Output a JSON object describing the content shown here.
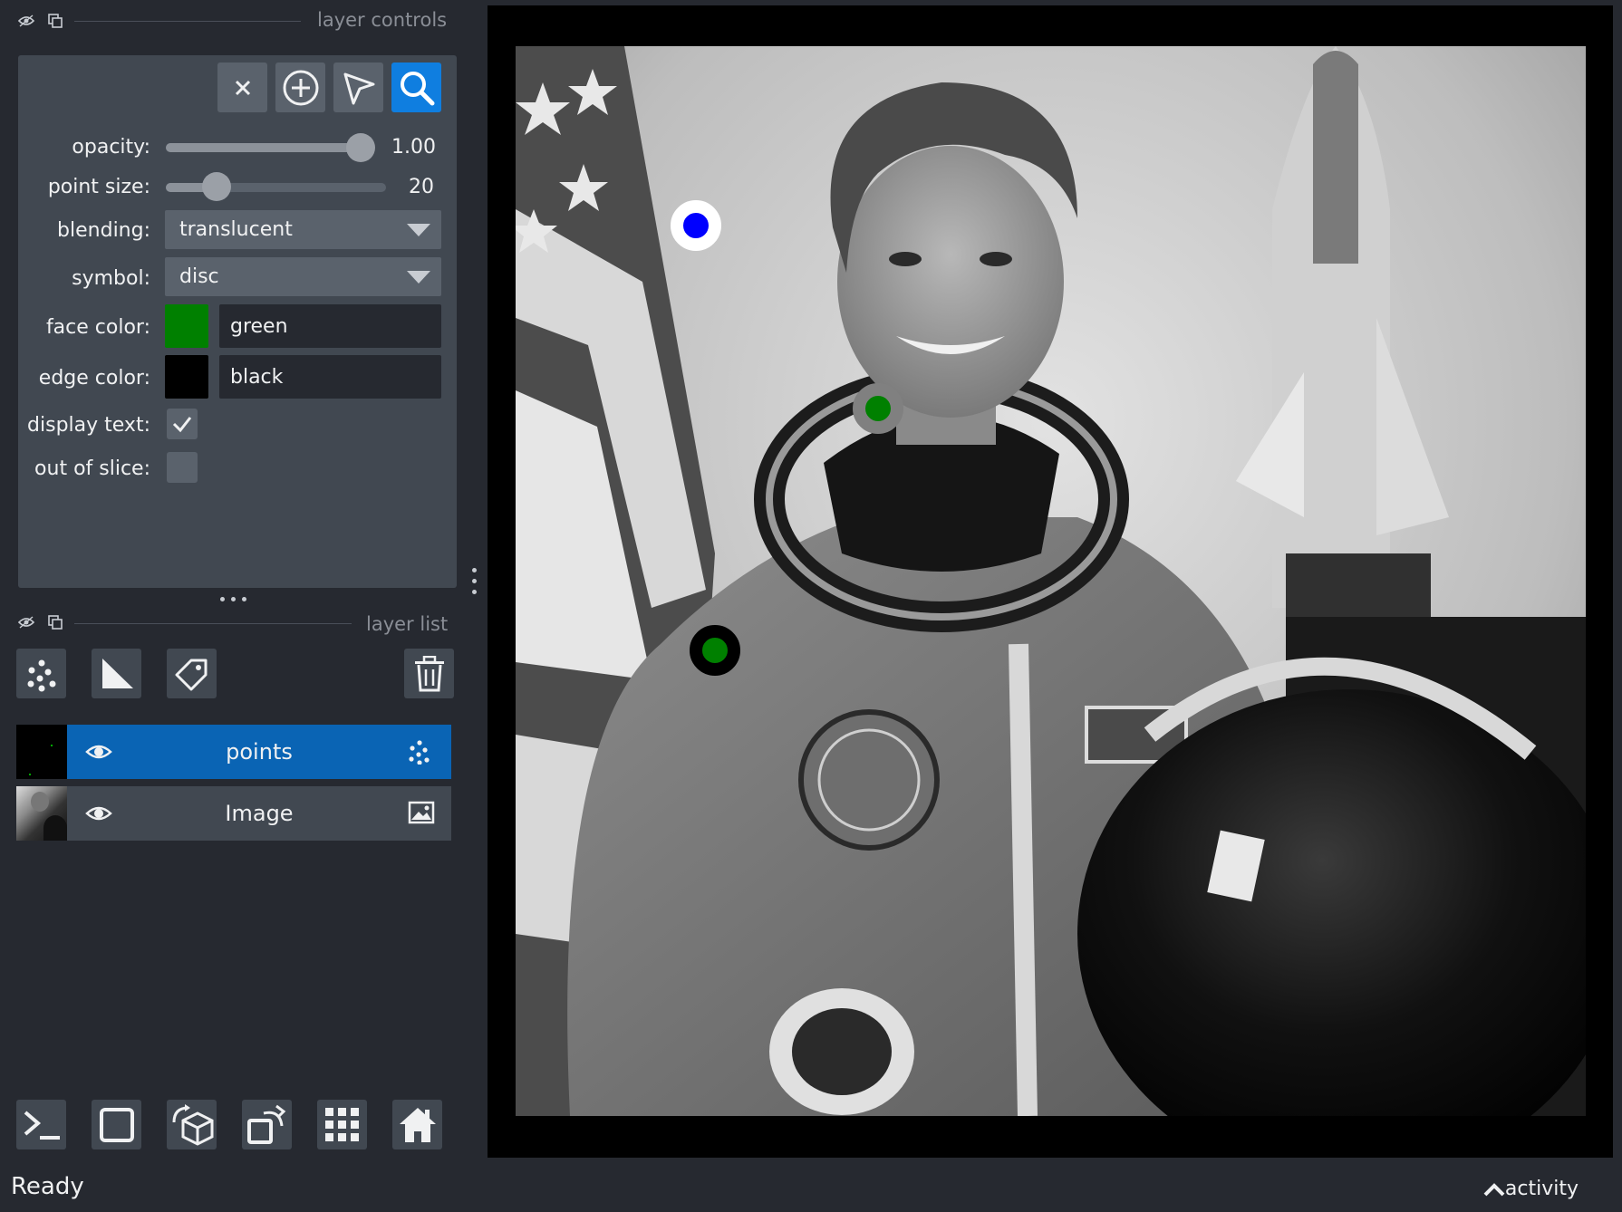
{
  "layer_controls": {
    "title": "layer controls",
    "tools": [
      "delete-selected",
      "add-points",
      "select-points",
      "pan-zoom"
    ],
    "opacity": {
      "label": "opacity:",
      "value": "1.00",
      "fraction": 1.0
    },
    "point_size": {
      "label": "point size:",
      "value": "20",
      "fraction": 0.2
    },
    "blending": {
      "label": "blending:",
      "value": "translucent"
    },
    "symbol": {
      "label": "symbol:",
      "value": "disc"
    },
    "face_color": {
      "label": "face color:",
      "value": "green",
      "swatch": "#008000"
    },
    "edge_color": {
      "label": "edge color:",
      "value": "black",
      "swatch": "#000000"
    },
    "display_text": {
      "label": "display text:",
      "checked": true
    },
    "out_of_slice": {
      "label": "out of slice:",
      "checked": false
    }
  },
  "layer_list": {
    "title": "layer list",
    "layers": [
      {
        "name": "points",
        "selected": true,
        "visible": true,
        "type_icon": "points-icon"
      },
      {
        "name": "Image",
        "selected": false,
        "visible": true,
        "type_icon": "image-icon"
      }
    ]
  },
  "status": {
    "text": "Ready",
    "activity": "activity"
  },
  "colors": {
    "accent": "#0f7ee0",
    "selected_layer": "#0a64b4",
    "panel": "#414851",
    "background": "#262930"
  },
  "points": [
    {
      "face": "#0000ff",
      "edge": "#ffffff"
    },
    {
      "face": "#008000",
      "edge": "#808080"
    },
    {
      "face": "#008000",
      "edge": "#000000"
    }
  ]
}
